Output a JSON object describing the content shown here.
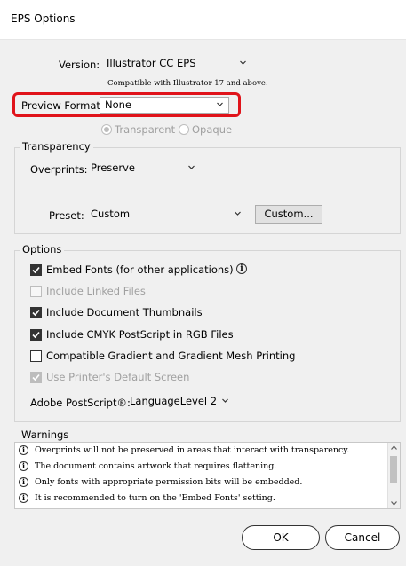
{
  "window": {
    "title": "EPS Options"
  },
  "version": {
    "label": "Version:",
    "value": "Illustrator CC EPS",
    "note": "Compatible with Illustrator 17 and above."
  },
  "preview_format": {
    "label": "Preview Format:",
    "value": "None",
    "options": {
      "transparent": "Transparent",
      "opaque": "Opaque"
    }
  },
  "transparency": {
    "title": "Transparency",
    "overprints_label": "Overprints:",
    "overprints_value": "Preserve",
    "preset_label": "Preset:",
    "preset_value": "Custom",
    "custom_button": "Custom..."
  },
  "options": {
    "title": "Options",
    "embed_fonts": "Embed Fonts (for other applications)",
    "include_linked": "Include Linked Files",
    "include_thumbnails": "Include Document Thumbnails",
    "include_cmyk": "Include CMYK PostScript in RGB Files",
    "compatible_gradient": "Compatible Gradient and Gradient Mesh Printing",
    "use_printer_screen": "Use Printer's Default Screen",
    "postscript_label": "Adobe PostScript®:",
    "postscript_value": "LanguageLevel 2"
  },
  "warnings": {
    "title": "Warnings",
    "items": [
      "Overprints will not be preserved in areas that interact with transparency.",
      "The document contains artwork that requires flattening.",
      "Only fonts with appropriate permission bits will be embedded.",
      "It is recommended to turn on the 'Embed Fonts' setting."
    ]
  },
  "buttons": {
    "ok": "OK",
    "cancel": "Cancel"
  },
  "icons": {
    "info": "i",
    "chevron": "chevron-down-icon",
    "check": "checkmark-icon"
  },
  "colors": {
    "highlight": "#e0131a"
  }
}
